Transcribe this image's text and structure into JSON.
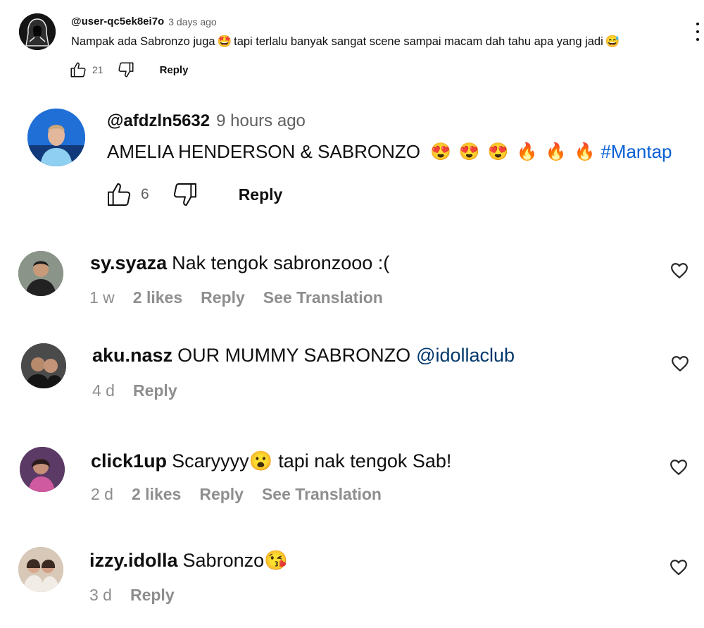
{
  "yt_comment": {
    "handle": "@user-qc5ek8ei7o",
    "time": "3 days ago",
    "text_before": "Nampak ada Sabronzo juga",
    "emoji1": "🤩",
    "text_middle": "tapi terlalu banyak sangat scene sampai macam dah tahu apa yang jadi",
    "emoji2": "😅",
    "likes": "21",
    "reply_label": "Reply",
    "icons": {
      "avatar": "hooded-figure-avatar",
      "like": "thumbs-up-icon",
      "dislike": "thumbs-down-icon",
      "more": "more-vertical-icon"
    }
  },
  "yt_reply": {
    "handle": "@afdzln5632",
    "time": "9 hours ago",
    "text": "AMELIA HENDERSON & SABRONZO",
    "emojis": [
      "😍",
      "😍",
      "😍",
      "🔥",
      "🔥",
      "🔥"
    ],
    "hashtag": "#Mantap",
    "likes": "6",
    "reply_label": "Reply",
    "hashtag_color": "#065fd4"
  },
  "ig_comments": [
    {
      "user": "sy.syaza",
      "text": "Nak tengok sabronzooo :(",
      "time": "1 w",
      "likes": "2 likes",
      "reply_label": "Reply",
      "translate_label": "See Translation"
    },
    {
      "user": "aku.nasz",
      "text": "OUR MUMMY SABRONZO",
      "mention": "@idollaclub",
      "time": "4 d",
      "reply_label": "Reply"
    },
    {
      "user": "click1up",
      "text_before": "Scaryyyy",
      "emoji": "😮",
      "text_after": "tapi nak tengok Sab!",
      "time": "2 d",
      "likes": "2 likes",
      "reply_label": "Reply",
      "translate_label": "See Translation"
    },
    {
      "user": "izzy.idolla",
      "text": "Sabronzo",
      "emoji": "😘",
      "time": "3 d",
      "reply_label": "Reply"
    }
  ],
  "colors": {
    "meta_gray": "#8e8e8e",
    "mention_blue": "#00376b",
    "yt_gray": "#606060"
  }
}
